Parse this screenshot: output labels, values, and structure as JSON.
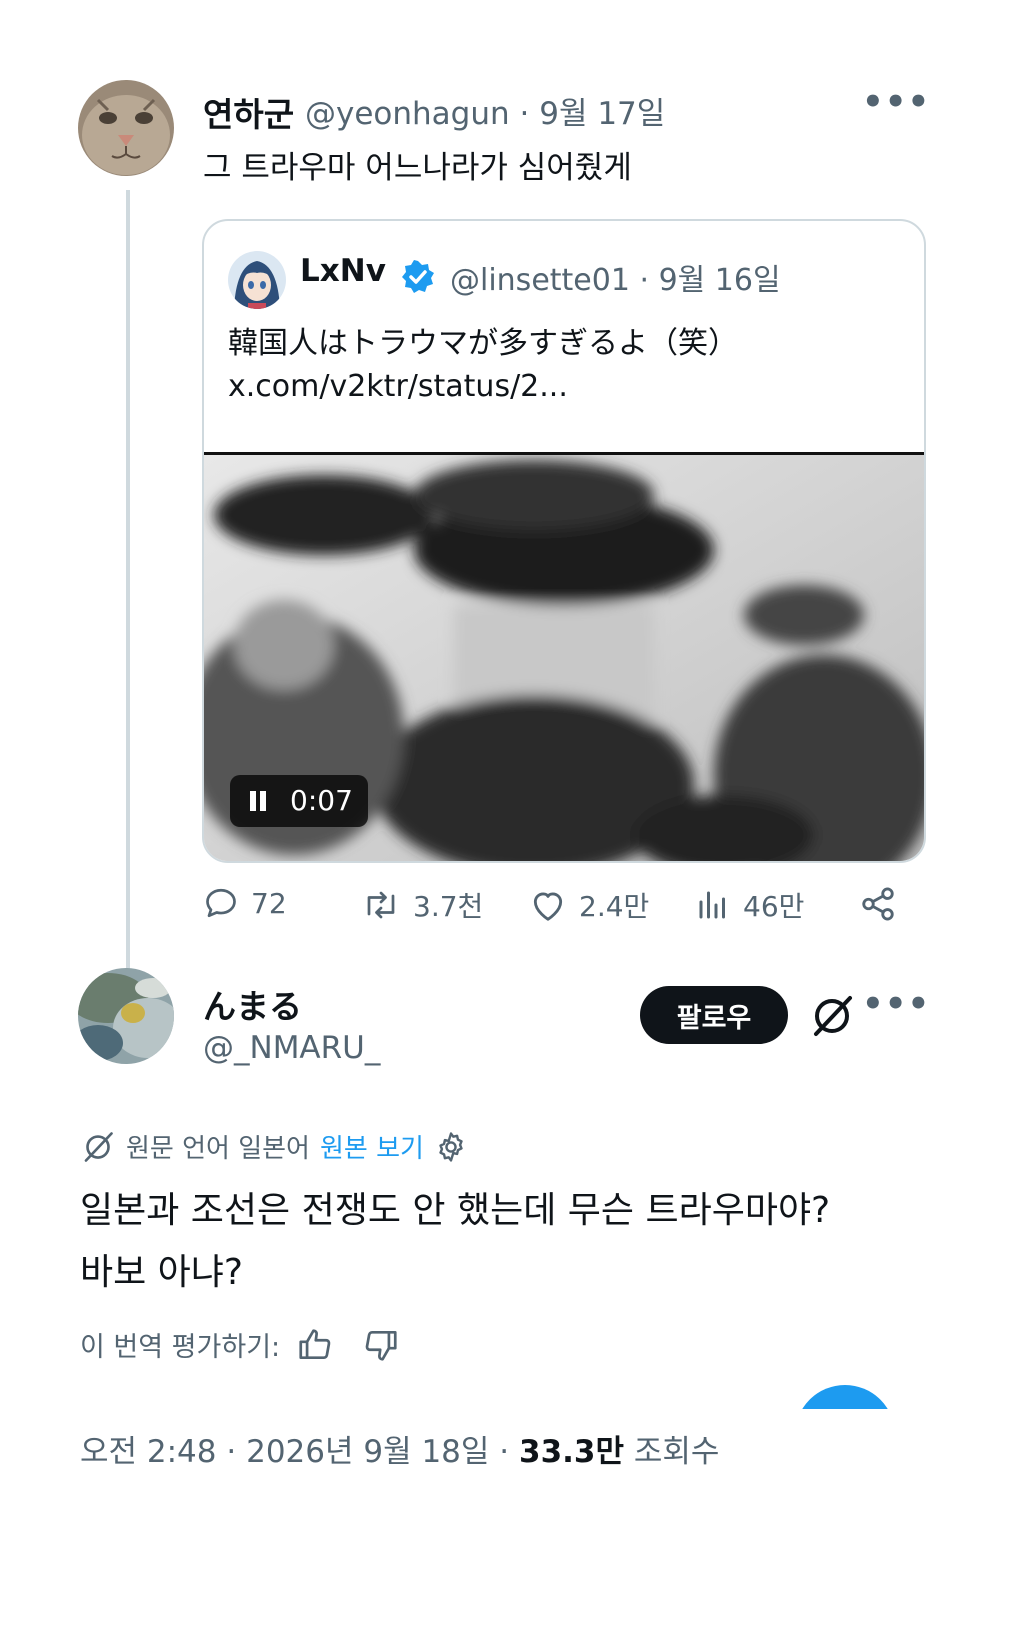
{
  "tweet1": {
    "display_name": "연하군",
    "handle": "@yeonhagun",
    "date": "9월 17일",
    "text": "그 트라우마 어느나라가 심어줬게",
    "avatar": "cat-face-avatar",
    "more_icon": "more-horizontal-icon"
  },
  "quote": {
    "display_name": "LxNv",
    "verified": true,
    "handle": "@linsette01",
    "date": "9월 16일",
    "text": "韓国人はトラウマが多すぎるよ（笑）",
    "link": "x.com/v2ktr/status/2...",
    "video_time": "0:07"
  },
  "actions": {
    "replies": "72",
    "reposts": "3.7천",
    "likes": "2.4만",
    "views": "46만"
  },
  "tweet2": {
    "display_name": "んまる",
    "handle": "@_NMARU_",
    "follow_label": "팔로우",
    "translate_note": "원문 언어 일본어",
    "view_original": "원본 보기",
    "text_line1": "일본과 조선은 전쟁도 안 했는데 무슨 트라우마야?",
    "text_line2": "바보 아냐?",
    "rate_label": "이 번역 평가하기:",
    "footer_time": "오전 2:48",
    "footer_date": "2026년 9월 18일",
    "footer_views": "33.3만",
    "footer_views_label": "조회수"
  },
  "colors": {
    "accent": "#1d9bf0",
    "text": "#0f1419",
    "muted": "#536471",
    "border": "#cfd9de"
  }
}
